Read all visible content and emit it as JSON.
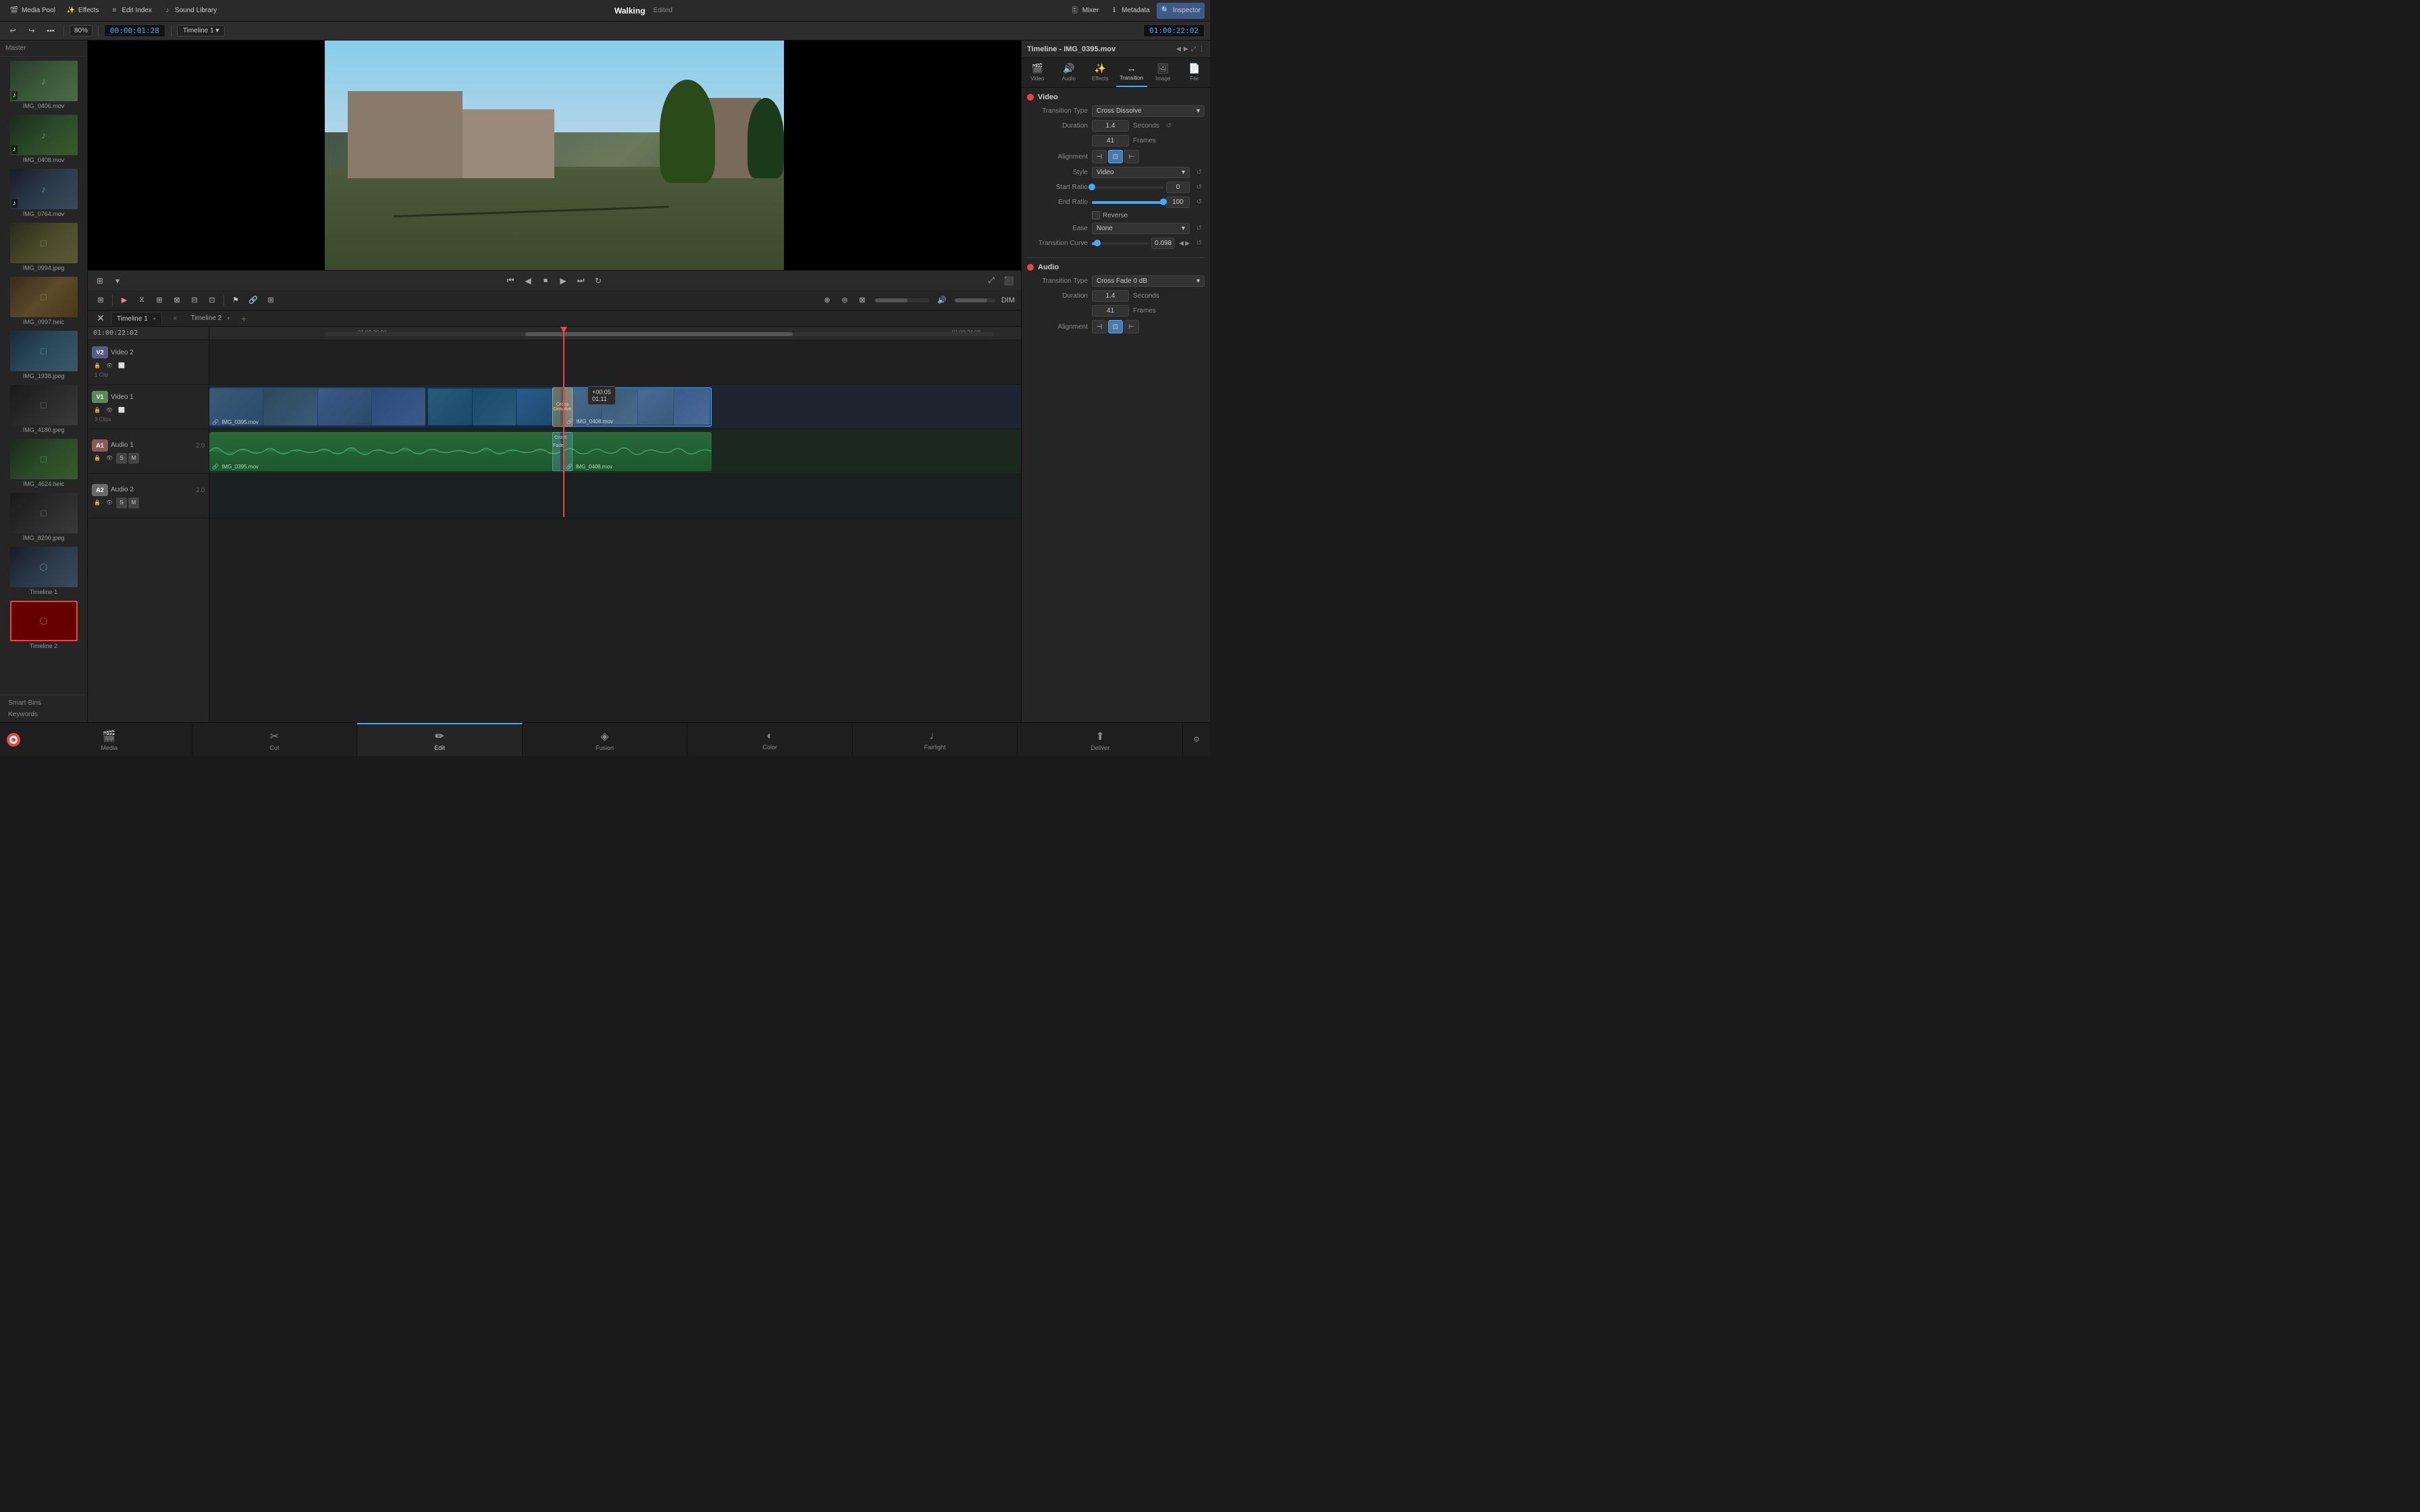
{
  "app": {
    "title": "Walking",
    "status": "Edited",
    "logo": "DaVinci Resolve 17"
  },
  "top_bar": {
    "sections": [
      {
        "id": "media-pool",
        "icon": "🎬",
        "label": "Media Pool"
      },
      {
        "id": "effects",
        "icon": "✨",
        "label": "Effects"
      },
      {
        "id": "edit-index",
        "icon": "≡",
        "label": "Edit Index"
      },
      {
        "id": "sound-library",
        "icon": "♪",
        "label": "Sound Library"
      }
    ],
    "right_sections": [
      {
        "id": "mixer",
        "icon": "🎚",
        "label": "Mixer"
      },
      {
        "id": "metadata",
        "icon": "ℹ",
        "label": "Metadata"
      },
      {
        "id": "inspector",
        "icon": "🔍",
        "label": "Inspector"
      }
    ]
  },
  "toolbar": {
    "zoom": "80%",
    "timecode": "00:00:01:28",
    "timeline_name": "Timeline 1",
    "timecode2": "01:00:22:02"
  },
  "preview": {
    "title": "Timeline - IMG_0395.mov"
  },
  "timeline": {
    "tabs": [
      {
        "id": "timeline1",
        "label": "Timeline 1",
        "active": true
      },
      {
        "id": "timeline2",
        "label": "Timeline 2",
        "active": false
      }
    ],
    "timecode": "01:00:22:02",
    "tracks": [
      {
        "id": "v2",
        "label": "V2",
        "name": "Video 2",
        "type": "video",
        "clips": "1 Clip"
      },
      {
        "id": "v1",
        "label": "V1",
        "name": "Video 1",
        "type": "video",
        "clips": "3 Clips"
      },
      {
        "id": "a1",
        "label": "A1",
        "name": "Audio 1",
        "type": "audio",
        "num": "2.0"
      },
      {
        "id": "a2",
        "label": "A2",
        "name": "Audio 2",
        "type": "audio",
        "num": "2.0"
      }
    ],
    "clips": [
      {
        "id": "v1-clip1",
        "track": "v1",
        "name": "IMG_0395.mov",
        "type": "video"
      },
      {
        "id": "v1-clip2",
        "track": "v1",
        "name": "IMG_0408.mov",
        "type": "video"
      },
      {
        "id": "a1-clip1",
        "track": "a1",
        "name": "IMG_0395.mov",
        "type": "audio"
      },
      {
        "id": "a1-clip2",
        "track": "a1",
        "name": "IMG_0408.mov",
        "type": "audio"
      }
    ],
    "transitions": [
      {
        "id": "cross-dissolve",
        "label": "Cross Dissolve"
      },
      {
        "id": "cross-fade",
        "label": "Cross Fade"
      }
    ],
    "tooltip": {
      "time_offset": "+00:05",
      "timecode": "01:11"
    },
    "ruler": {
      "marks": [
        "01:00:20:00",
        "01:00:24:00"
      ]
    }
  },
  "inspector": {
    "title": "Timeline - IMG_0395.mov",
    "tabs": [
      {
        "id": "video",
        "icon": "🎬",
        "label": "Video"
      },
      {
        "id": "audio",
        "icon": "🔊",
        "label": "Audio"
      },
      {
        "id": "effects",
        "icon": "✨",
        "label": "Effects"
      },
      {
        "id": "transition",
        "icon": "↔",
        "label": "Transition",
        "active": true
      },
      {
        "id": "image",
        "icon": "🖼",
        "label": "Image"
      },
      {
        "id": "file",
        "icon": "📄",
        "label": "File"
      }
    ],
    "video_section": {
      "title": "Video",
      "transition_type": "Cross Dissolve",
      "duration_seconds": "1.4",
      "duration_unit_s": "Seconds",
      "duration_frames": "41",
      "duration_unit_f": "Frames",
      "alignment": "center",
      "style": "Video",
      "start_ratio": "0",
      "end_ratio": "100",
      "reverse": false,
      "ease": "None",
      "transition_curve": "0.098"
    },
    "audio_section": {
      "title": "Audio",
      "transition_type": "Cross Fade 0 dB",
      "duration_seconds": "1.4",
      "duration_unit_s": "Seconds",
      "duration_frames": "41",
      "duration_unit_f": "Frames"
    }
  },
  "media_items": [
    {
      "id": "img0406",
      "name": "IMG_0406.mov",
      "thumb_class": "thumb-gradient-1",
      "icon": "♪"
    },
    {
      "id": "img0408",
      "name": "IMG_0408.mov",
      "thumb_class": "thumb-gradient-2",
      "icon": "♪"
    },
    {
      "id": "img0764",
      "name": "IMG_0764.mov",
      "thumb_class": "thumb-gradient-3",
      "icon": "♪"
    },
    {
      "id": "img0994",
      "name": "IMG_0994.jpeg",
      "thumb_class": "thumb-gradient-4",
      "icon": "□"
    },
    {
      "id": "img0997",
      "name": "IMG_0997.heic",
      "thumb_class": "thumb-gradient-5",
      "icon": "□"
    },
    {
      "id": "img1938",
      "name": "IMG_1938.jpeg",
      "thumb_class": "thumb-gradient-6",
      "icon": "□"
    },
    {
      "id": "img4180",
      "name": "IMG_4180.jpeg",
      "thumb_class": "thumb-gradient-7",
      "icon": "□"
    },
    {
      "id": "img4624",
      "name": "IMG_4624.heic",
      "thumb_class": "thumb-gradient-2",
      "icon": "□"
    },
    {
      "id": "img8200",
      "name": "IMG_8200.jpeg",
      "thumb_class": "thumb-gradient-7",
      "icon": "□"
    },
    {
      "id": "timeline1",
      "name": "Timeline 1",
      "thumb_class": "thumb-gradient-3",
      "icon": "⬡"
    },
    {
      "id": "timeline2",
      "name": "Timeline 2",
      "thumb_class": "thumb-gradient-red",
      "icon": "⬡",
      "selected": true
    }
  ],
  "sidebar": {
    "header": "Master",
    "footer_items": [
      "Smart Bins",
      "Keywords"
    ]
  },
  "bottom_tabs": [
    {
      "id": "media",
      "icon": "🎬",
      "label": "Media"
    },
    {
      "id": "cut",
      "icon": "✂",
      "label": "Cut"
    },
    {
      "id": "edit",
      "icon": "✏",
      "label": "Edit",
      "active": true
    },
    {
      "id": "fusion",
      "icon": "◈",
      "label": "Fusion"
    },
    {
      "id": "color",
      "icon": "◐",
      "label": "Color"
    },
    {
      "id": "fairlight",
      "icon": "♩",
      "label": "Fairlight"
    },
    {
      "id": "deliver",
      "icon": "⬆",
      "label": "Deliver"
    }
  ]
}
